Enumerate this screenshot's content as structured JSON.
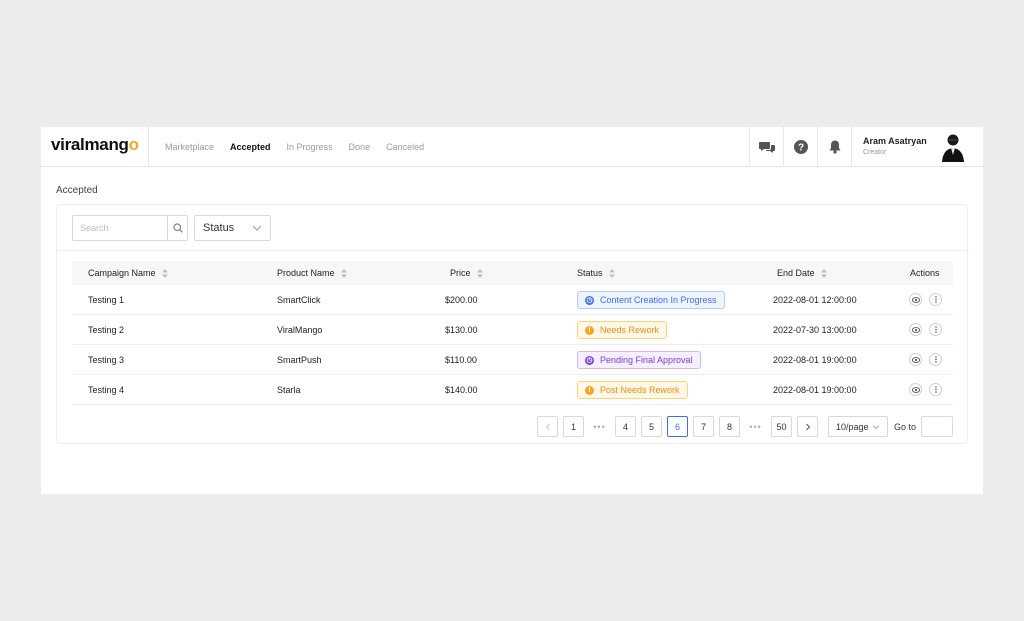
{
  "app": {
    "logo_main": "viralmang",
    "logo_accent": "o",
    "nav": [
      {
        "label": "Marketplace",
        "active": false
      },
      {
        "label": "Accepted",
        "active": true
      },
      {
        "label": "In Progress",
        "active": false
      },
      {
        "label": "Done",
        "active": false
      },
      {
        "label": "Canceled",
        "active": false
      }
    ],
    "header_icons": [
      "chat-icon",
      "help-icon",
      "bell-icon"
    ],
    "user": {
      "name": "Aram Asatryan",
      "role": "Creator"
    }
  },
  "page": {
    "title": "Accepted"
  },
  "filters": {
    "search_placeholder": "Search",
    "status_label": "Status"
  },
  "table": {
    "columns": [
      "Campaign Name",
      "Product Name",
      "Price",
      "Status",
      "End Date",
      "Actions"
    ],
    "rows": [
      {
        "campaign": "Testing 1",
        "product": "SmartClick",
        "price": "$200.00",
        "status": "Content Creation In Progress",
        "status_kind": "blue",
        "end_date": "2022-08-01 12:00:00"
      },
      {
        "campaign": "Testing 2",
        "product": "ViralMango",
        "price": "$130.00",
        "status": "Needs Rework",
        "status_kind": "orange",
        "end_date": "2022-07-30 13:00:00"
      },
      {
        "campaign": "Testing 3",
        "product": "SmartPush",
        "price": "$110.00",
        "status": "Pending Final Approval",
        "status_kind": "purple",
        "end_date": "2022-08-01 19:00:00"
      },
      {
        "campaign": "Testing 4",
        "product": "Starla",
        "price": "$140.00",
        "status": "Post Needs Rework",
        "status_kind": "orange",
        "end_date": "2022-08-01 19:00:00"
      }
    ]
  },
  "pagination": {
    "pages": [
      "1",
      "4",
      "5",
      "6",
      "7",
      "8",
      "50"
    ],
    "current": "6",
    "ellipsis": "•••",
    "page_size": "10/page",
    "goto_label": "Go to"
  },
  "colors": {
    "accent": "#f5a623",
    "status_blue": "#3b6ff5",
    "status_orange": "#f5a623",
    "status_purple": "#7b3fd6"
  }
}
